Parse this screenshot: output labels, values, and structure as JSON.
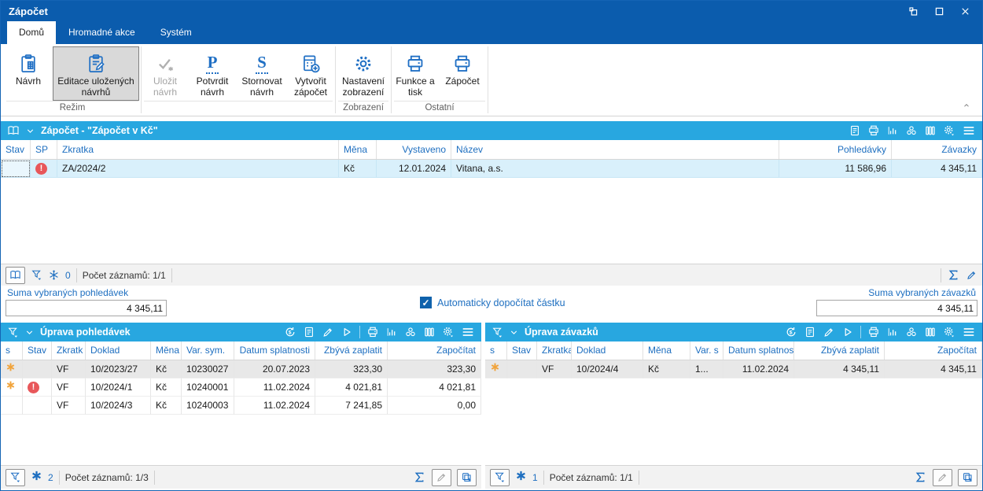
{
  "window": {
    "title": "Zápočet"
  },
  "tabs": [
    {
      "label": "Domů",
      "active": true
    },
    {
      "label": "Hromadné akce",
      "active": false
    },
    {
      "label": "Systém",
      "active": false
    }
  ],
  "ribbon": {
    "groups": [
      {
        "label": "Režim",
        "buttons": [
          {
            "label": "Návrh",
            "icon": "clipboard-icon",
            "state": "normal"
          },
          {
            "label": "Editace uložených návrhů",
            "icon": "clipboard-edit-icon",
            "state": "selected"
          }
        ]
      },
      {
        "label": "",
        "buttons": [
          {
            "label": "Uložit návrh",
            "icon": "check-star-icon",
            "state": "disabled"
          },
          {
            "label": "Potvrdit návrh",
            "icon": "letter-p-icon",
            "state": "normal"
          },
          {
            "label": "Stornovat návrh",
            "icon": "letter-s-icon",
            "state": "normal"
          },
          {
            "label": "Vytvořit zápočet",
            "icon": "calculator-plus-icon",
            "state": "normal"
          }
        ]
      },
      {
        "label": "Zobrazení",
        "buttons": [
          {
            "label": "Nastavení zobrazení",
            "icon": "gear-icon",
            "state": "normal"
          }
        ]
      },
      {
        "label": "Ostatní",
        "buttons": [
          {
            "label": "Funkce a tisk",
            "icon": "printer-icon",
            "state": "normal"
          },
          {
            "label": "Zápočet",
            "icon": "printer-icon",
            "state": "normal"
          }
        ]
      }
    ],
    "letters": {
      "p": "P",
      "s": "S"
    }
  },
  "main_grid": {
    "title": "Zápočet - \"Zápočet v Kč\"",
    "columns": [
      "Stav",
      "SP",
      "Zkratka",
      "Měna",
      "Vystaveno",
      "Název",
      "Pohledávky",
      "Závazky"
    ],
    "rows": [
      {
        "stav": "",
        "sp": "!",
        "zkratka": "ZA/2024/2",
        "mena": "Kč",
        "vystaveno": "12.01.2024",
        "nazev": "Vitana, a.s.",
        "pohledavky": "11 586,96",
        "zavazky": "4 345,11"
      }
    ],
    "status": {
      "flag_count": "0",
      "records": "Počet záznamů: 1/1"
    }
  },
  "sums": {
    "left_label": "Suma vybraných pohledávek",
    "left_value": "4 345,11",
    "checkbox_label": "Automaticky dopočítat částku",
    "checkbox_checked": true,
    "right_label": "Suma vybraných závazků",
    "right_value": "4 345,11"
  },
  "receivables_grid": {
    "title": "Úprava pohledávek",
    "columns": [
      "s",
      "Stav",
      "Zkratk",
      "Doklad",
      "Měna",
      "Var. sym.",
      "Datum splatnosti",
      "Zbývá zaplatit",
      "Započítat"
    ],
    "rows": [
      {
        "s": "*",
        "stav": "",
        "zkratka": "VF",
        "doklad": "10/2023/27",
        "mena": "Kč",
        "varsym": "10230027",
        "datum": "20.07.2023",
        "zbyva": "323,30",
        "zapocitat": "323,30"
      },
      {
        "s": "*",
        "stav": "!",
        "zkratka": "VF",
        "doklad": "10/2024/1",
        "mena": "Kč",
        "varsym": "10240001",
        "datum": "11.02.2024",
        "zbyva": "4 021,81",
        "zapocitat": "4 021,81"
      },
      {
        "s": "",
        "stav": "",
        "zkratka": "VF",
        "doklad": "10/2024/3",
        "mena": "Kč",
        "varsym": "10240003",
        "datum": "11.02.2024",
        "zbyva": "7 241,85",
        "zapocitat": "0,00"
      }
    ],
    "status": {
      "star_count": "2",
      "records": "Počet záznamů: 1/3"
    }
  },
  "payables_grid": {
    "title": "Úprava závazků",
    "columns": [
      "s",
      "Stav",
      "Zkratka",
      "Doklad",
      "Měna",
      "Var. s",
      "Datum splatnosti",
      "Zbývá zaplatit",
      "Započítat"
    ],
    "rows": [
      {
        "s": "*",
        "stav": "",
        "zkratka": "VF",
        "doklad": "10/2024/4",
        "mena": "Kč",
        "varsym": "1...",
        "datum": "11.02.2024",
        "zbyva": "4 345,11",
        "zapocitat": "4 345,11"
      }
    ],
    "status": {
      "star_count": "1",
      "records": "Počet záznamů: 1/1"
    }
  },
  "colors": {
    "titlebar_blue": "#0b5cad",
    "panel_header_blue": "#28a7e0",
    "selected_row_blue": "#d9f0fb",
    "accent_blue": "#1e6fc0",
    "asterisk_orange": "#f1a33a",
    "error_red": "#e8575a"
  }
}
